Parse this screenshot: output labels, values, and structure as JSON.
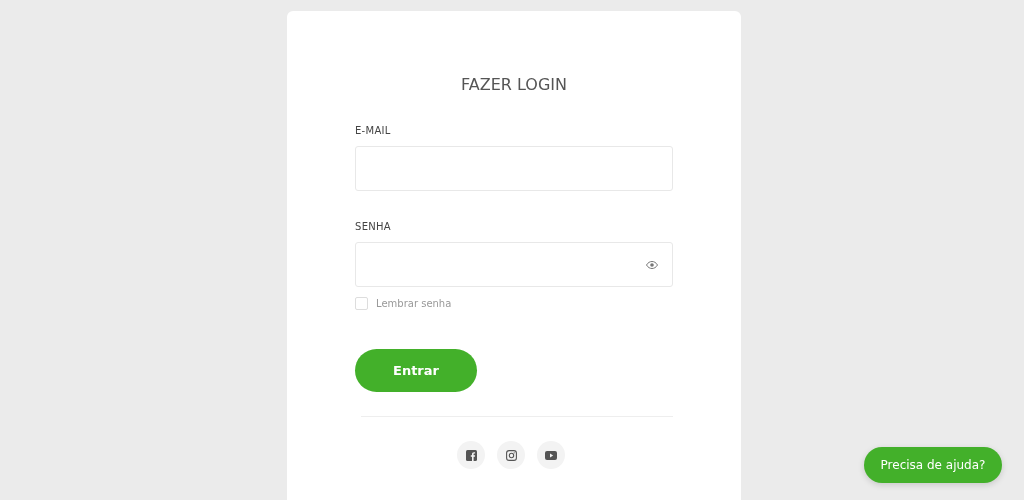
{
  "title": "FAZER LOGIN",
  "fields": [
    {
      "label": "E-MAIL",
      "kind": "text"
    },
    {
      "label": "SENHA",
      "kind": "password"
    }
  ],
  "remember": {
    "label": "Lembrar senha",
    "checked": false
  },
  "submit": "Entrar",
  "social": [
    {
      "kind": "facebook"
    },
    {
      "kind": "instagram"
    },
    {
      "kind": "youtube"
    }
  ],
  "help_button": "Precisa de ajuda?"
}
